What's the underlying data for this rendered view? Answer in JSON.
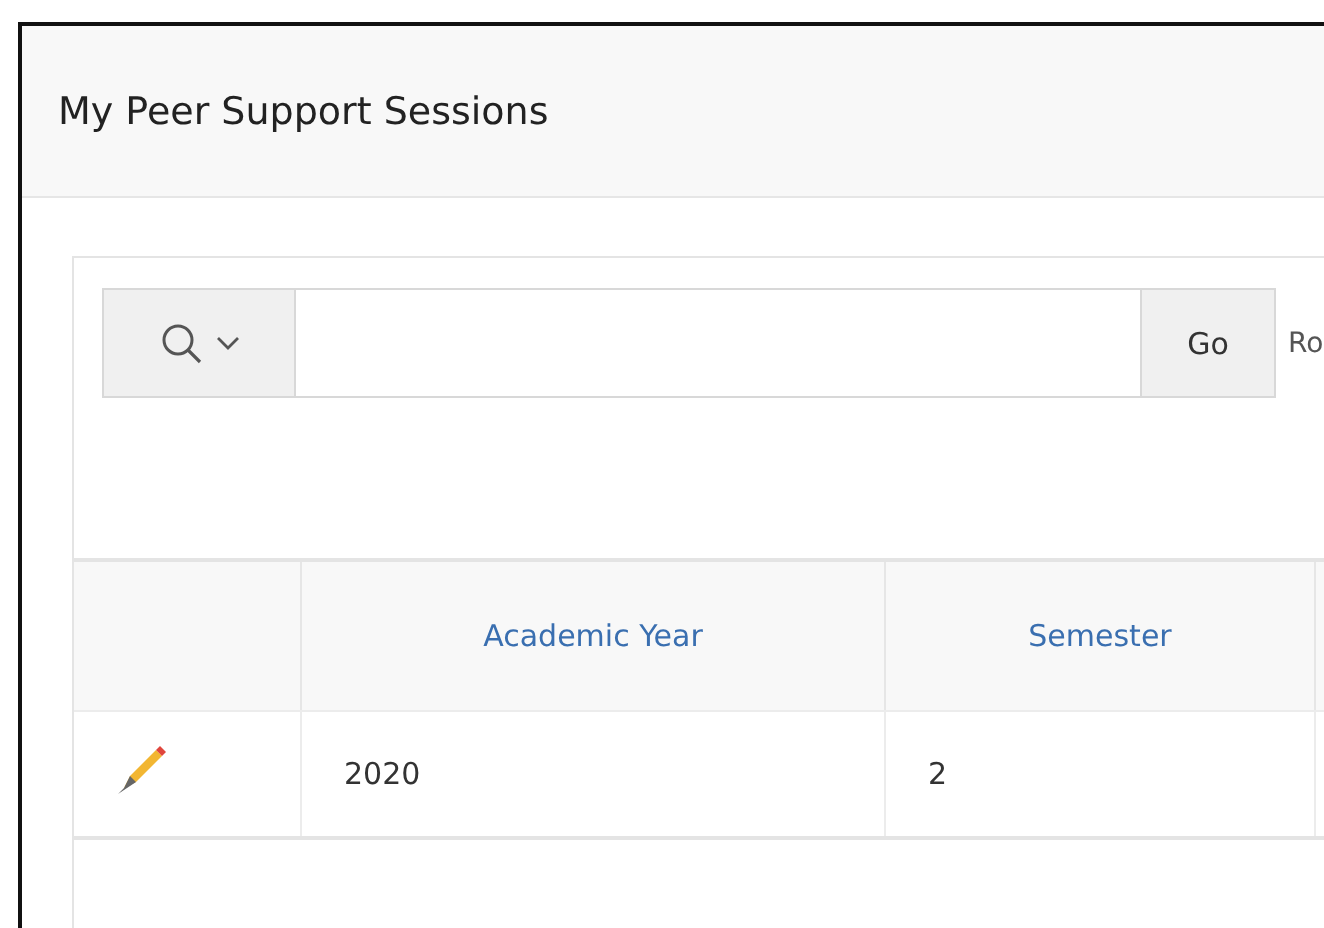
{
  "region": {
    "title": "My Peer Support Sessions"
  },
  "search_bar": {
    "go_button": "Go",
    "rows_label": "Ro"
  },
  "table": {
    "columns": [
      "Academic Year",
      "Semester"
    ],
    "rows": [
      {
        "cells": [
          "2020",
          "2"
        ]
      }
    ]
  }
}
